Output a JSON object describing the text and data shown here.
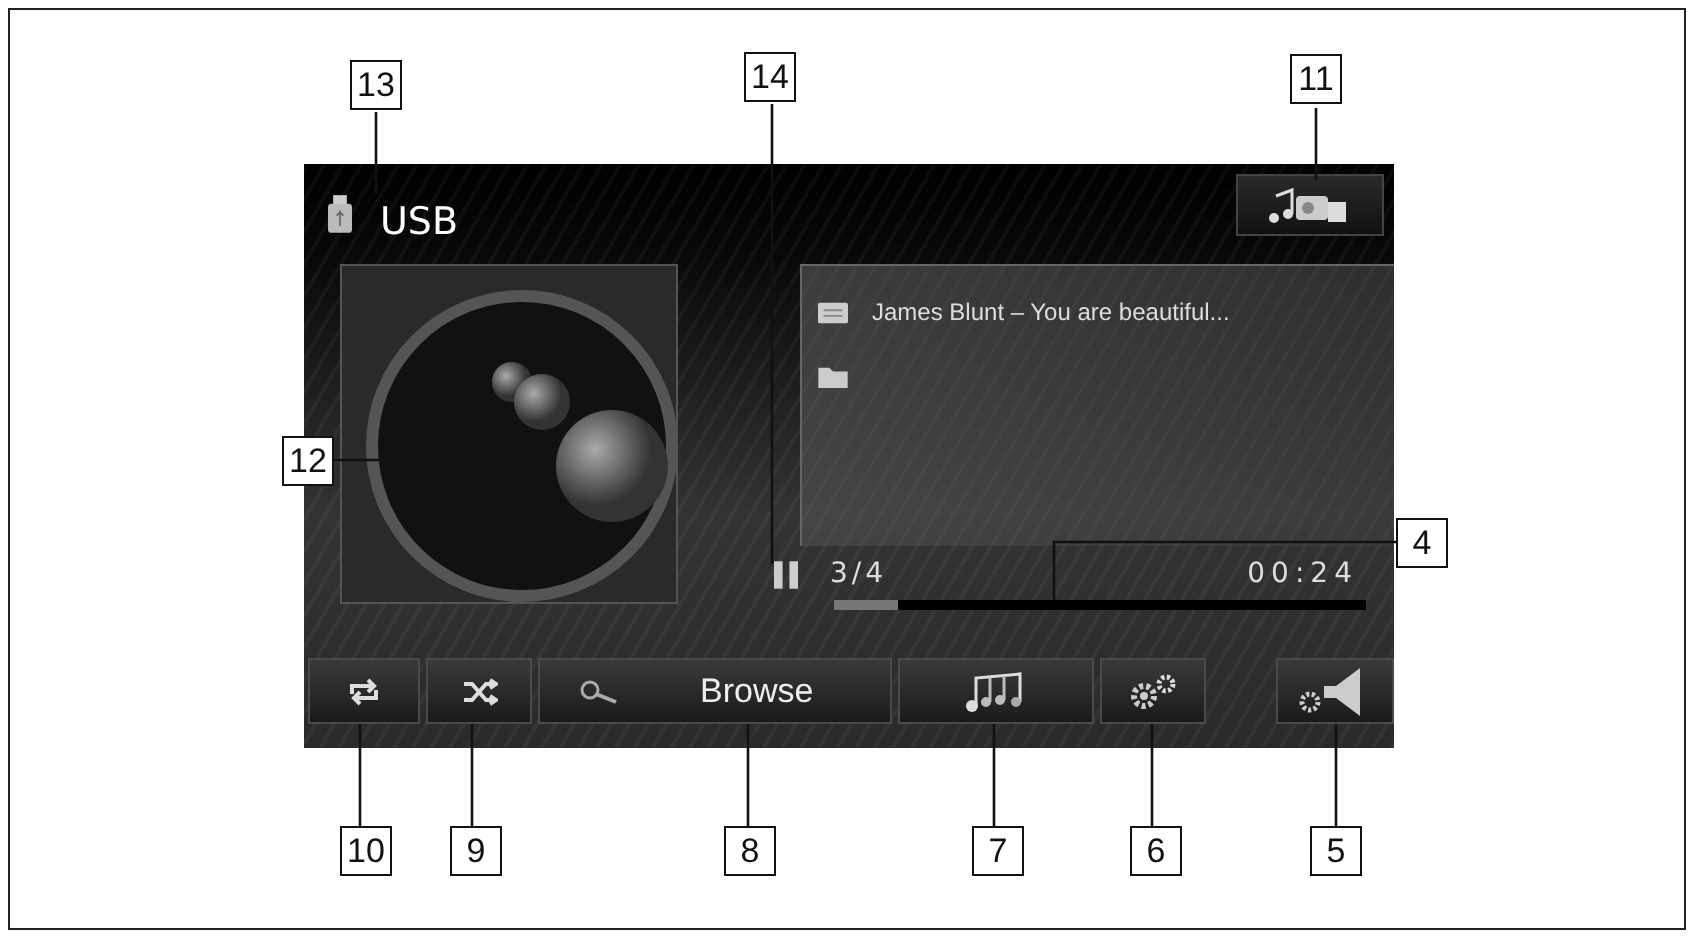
{
  "source": {
    "title": "USB"
  },
  "track": {
    "title": "James Blunt – You are beautiful...",
    "position": "3/4",
    "time": "00:24"
  },
  "progress": {
    "level": 0.12
  },
  "controls": [
    {
      "kind": "repeat"
    },
    {
      "kind": "shuffle"
    },
    {
      "kind": "browse",
      "label": "Browse"
    },
    {
      "kind": "music"
    },
    {
      "kind": "settings"
    }
  ],
  "callouts": [
    {
      "label": "13"
    },
    {
      "label": "14"
    },
    {
      "label": "11"
    },
    {
      "label": "12"
    },
    {
      "label": "4"
    },
    {
      "label": "10"
    },
    {
      "label": "9"
    },
    {
      "label": "8"
    },
    {
      "label": "7"
    },
    {
      "label": "6"
    },
    {
      "label": "5"
    }
  ]
}
